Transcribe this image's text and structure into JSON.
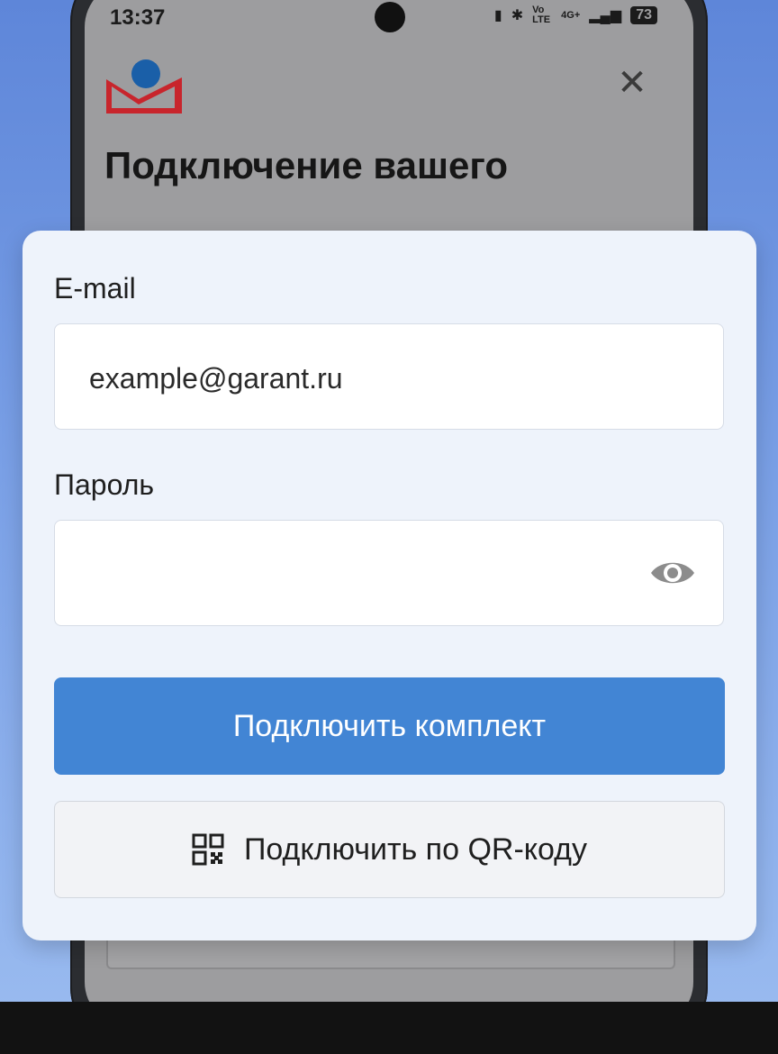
{
  "status_bar": {
    "time": "13:37",
    "network": "4G+",
    "volte": "Vo LTE",
    "battery": "73"
  },
  "background_screen": {
    "title": "Подключение вашего"
  },
  "form": {
    "email_label": "E-mail",
    "email_value": "example@garant.ru",
    "password_label": "Пароль",
    "password_value": "",
    "connect_button": "Подключить комплект",
    "qr_button": "Подключить по QR-коду"
  },
  "colors": {
    "primary": "#4285d4",
    "card_bg": "#eef3fb",
    "logo_blue": "#1a5fa8",
    "logo_red": "#c8252c"
  },
  "icons": {
    "close": "close-icon",
    "eye": "eye-icon",
    "qr": "qr-code-icon"
  }
}
